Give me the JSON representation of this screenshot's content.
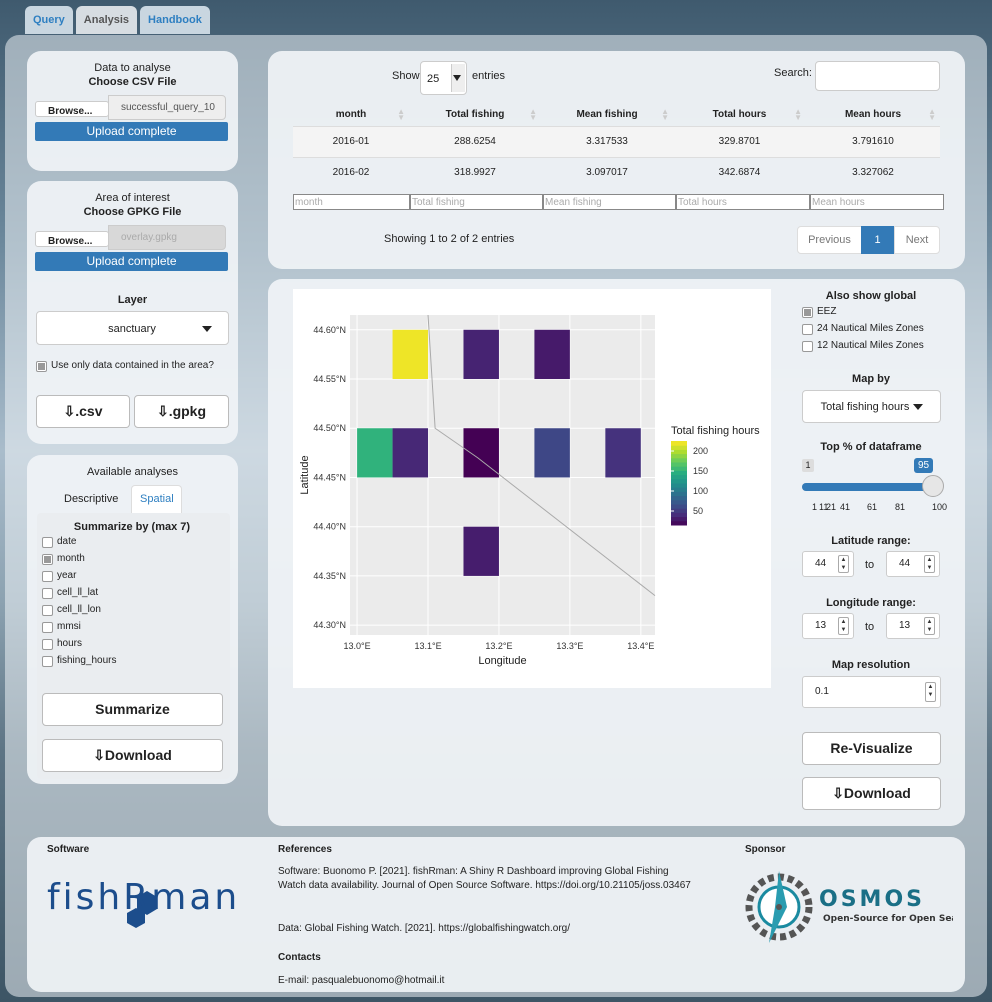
{
  "tabs": [
    "Query",
    "Analysis",
    "Handbook"
  ],
  "left": {
    "data_panel": {
      "title": "Data to analyse",
      "subtitle": "Choose CSV File",
      "browse": "Browse...",
      "file": "successful_query_10",
      "status": "Upload complete"
    },
    "area_panel": {
      "title": "Area of interest",
      "subtitle": "Choose GPKG File",
      "browse": "Browse...",
      "file": "overlay.gpkg",
      "status": "Upload complete",
      "layer_label": "Layer",
      "layer_value": "sanctuary",
      "use_area_label": "Use only data contained in the area?",
      "csv_button": ".csv",
      "gpkg_button": ".gpkg"
    },
    "analyses_panel": {
      "title": "Available analyses",
      "tab_descriptive": "Descriptive",
      "tab_spatial": "Spatial",
      "summarize_label": "Summarize by (max 7)",
      "fields": [
        {
          "label": "date",
          "checked": false
        },
        {
          "label": "month",
          "checked": true
        },
        {
          "label": "year",
          "checked": false
        },
        {
          "label": "cell_ll_lat",
          "checked": false
        },
        {
          "label": "cell_ll_lon",
          "checked": false
        },
        {
          "label": "mmsi",
          "checked": false
        },
        {
          "label": "hours",
          "checked": false
        },
        {
          "label": "fishing_hours",
          "checked": false
        }
      ],
      "summarize_button": "Summarize",
      "download_button": "Download"
    }
  },
  "table": {
    "show": "Show",
    "entries_value": "25",
    "entries": "entries",
    "search_label": "Search:",
    "columns": [
      "month",
      "Total fishing",
      "Mean fishing",
      "Total hours",
      "Mean hours"
    ],
    "rows": [
      [
        "2016-01",
        "288.6254",
        "3.317533",
        "329.8701",
        "3.791610"
      ],
      [
        "2016-02",
        "318.9927",
        "3.097017",
        "342.6874",
        "3.327062"
      ]
    ],
    "info": "Showing 1 to 2 of 2 entries",
    "prev": "Previous",
    "page": "1",
    "next": "Next"
  },
  "map_controls": {
    "global_label": "Also show global",
    "layers": [
      {
        "label": "EEZ",
        "checked": true
      },
      {
        "label": "24 Nautical Miles Zones",
        "checked": false
      },
      {
        "label": "12 Nautical Miles Zones",
        "checked": false
      }
    ],
    "map_by_label": "Map by",
    "map_by_value": "Total fishing hours",
    "top_label": "Top % of dataframe",
    "slider_min": "1",
    "slider_value": "95",
    "slider_ticks": [
      "1",
      "11",
      "21",
      "41",
      "61",
      "81",
      "100"
    ],
    "slider_fraction": 0.95,
    "lat_label": "Latitude range:",
    "lat_from": "44",
    "lat_to": "44",
    "to": "to",
    "lon_label": "Longitude range:",
    "lon_from": "13",
    "lon_to": "13",
    "res_label": "Map resolution",
    "res_value": "0.1",
    "revisualize_button": "Re-Visualize",
    "download_button": "Download"
  },
  "chart_data": {
    "type": "heatmap",
    "xlabel": "Longitude",
    "ylabel": "Latitude",
    "xlim": [
      12.99,
      13.42
    ],
    "ylim": [
      44.29,
      44.615
    ],
    "x_ticks": [
      {
        "v": 13.0,
        "label": "13.0°E"
      },
      {
        "v": 13.1,
        "label": "13.1°E"
      },
      {
        "v": 13.2,
        "label": "13.2°E"
      },
      {
        "v": 13.3,
        "label": "13.3°E"
      },
      {
        "v": 13.4,
        "label": "13.4°E"
      }
    ],
    "y_ticks": [
      {
        "v": 44.3,
        "label": "44.30°N"
      },
      {
        "v": 44.35,
        "label": "44.35°N"
      },
      {
        "v": 44.4,
        "label": "44.40°N"
      },
      {
        "v": 44.45,
        "label": "44.45°N"
      },
      {
        "v": 44.5,
        "label": "44.50°N"
      },
      {
        "v": 44.55,
        "label": "44.55°N"
      },
      {
        "v": 44.6,
        "label": "44.60°N"
      }
    ],
    "cell_size": 0.05,
    "cells": [
      {
        "lon": 13.05,
        "lat": 44.55,
        "value": 220
      },
      {
        "lon": 13.15,
        "lat": 44.55,
        "value": 35
      },
      {
        "lon": 13.25,
        "lat": 44.55,
        "value": 30
      },
      {
        "lon": 13.0,
        "lat": 44.45,
        "value": 150
      },
      {
        "lon": 13.05,
        "lat": 44.45,
        "value": 38
      },
      {
        "lon": 13.15,
        "lat": 44.45,
        "value": 15
      },
      {
        "lon": 13.25,
        "lat": 44.45,
        "value": 60
      },
      {
        "lon": 13.35,
        "lat": 44.45,
        "value": 45
      },
      {
        "lon": 13.15,
        "lat": 44.35,
        "value": 32
      }
    ],
    "legend_title": "Total fishing hours",
    "legend_ticks": [
      50,
      100,
      150,
      200
    ],
    "legend_range": [
      15,
      225
    ],
    "boundary_line": [
      [
        13.1,
        44.615
      ],
      [
        13.11,
        44.5
      ],
      [
        13.17,
        44.47
      ],
      [
        13.42,
        44.33
      ]
    ]
  },
  "footer": {
    "software_h": "Software",
    "logo_text": "fishRman",
    "references_h": "References",
    "ref1": "Software: Buonomo P. [2021]. fishRman: A Shiny R Dashboard improving Global Fishing Watch data availability. Journal of Open Source Software. https://doi.org/10.21105/joss.03467",
    "ref2": "Data: Global Fishing Watch. [2021]. https://globalfishingwatch.org/",
    "contacts_h": "Contacts",
    "email": "E-mail: pasqualebuonomo@hotmail.it",
    "sponsor_h": "Sponsor",
    "sponsor_name": "OSMOS",
    "sponsor_tag": "Open-Source for Open Seas"
  }
}
